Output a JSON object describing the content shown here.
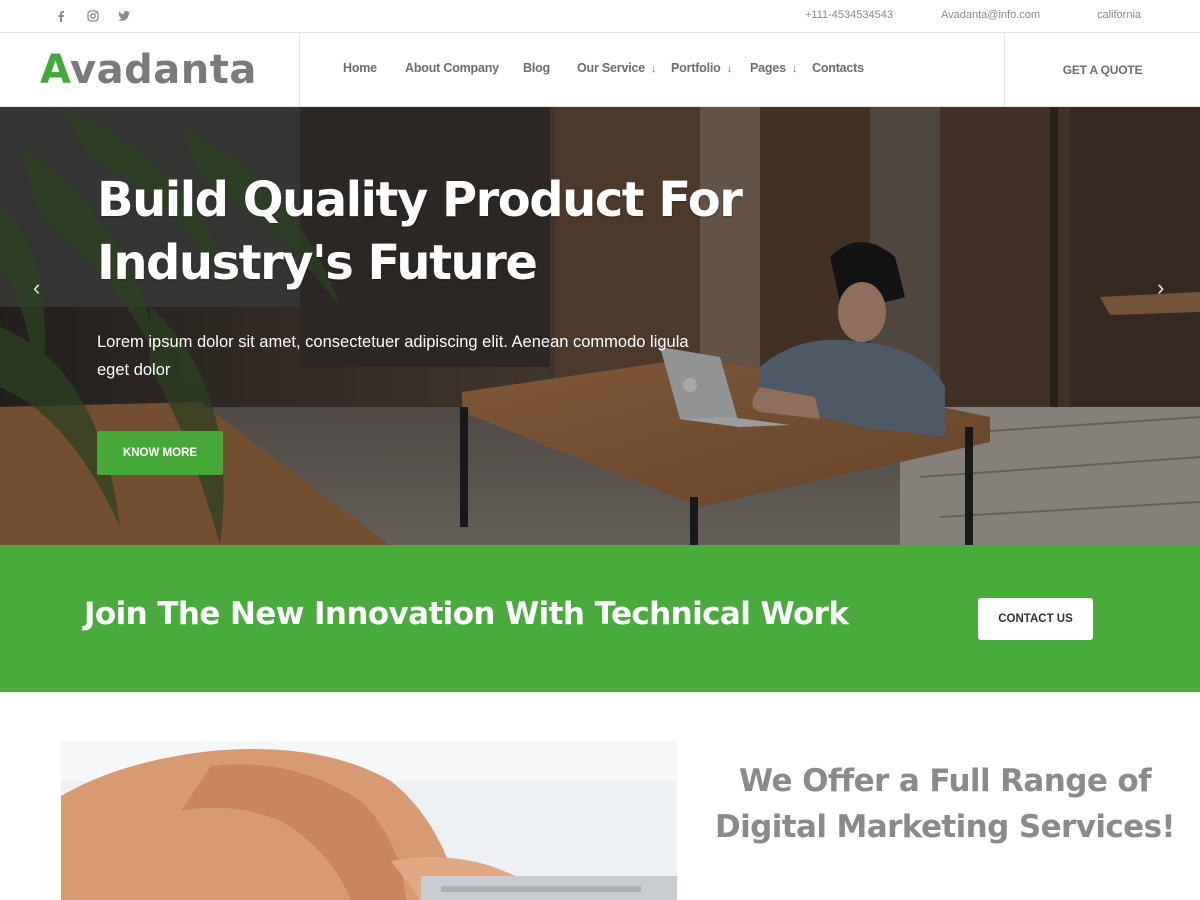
{
  "topbar": {
    "social": [
      {
        "icon": "facebook-icon",
        "glyph": "f"
      },
      {
        "icon": "instagram-icon",
        "glyph": ""
      },
      {
        "icon": "twitter-icon",
        "glyph": ""
      }
    ],
    "phone": "+111-4534534543",
    "email": "Avadanta@info.com",
    "location": "california"
  },
  "header": {
    "logo_accent": "A",
    "logo_rest": "vadanta",
    "nav": [
      {
        "label": "Home",
        "dropdown": false
      },
      {
        "label": "About Company",
        "dropdown": false
      },
      {
        "label": "Blog",
        "dropdown": false
      },
      {
        "label": "Our Service",
        "dropdown": true
      },
      {
        "label": "Portfolio",
        "dropdown": true
      },
      {
        "label": "Pages",
        "dropdown": true
      },
      {
        "label": "Contacts",
        "dropdown": false
      }
    ],
    "dropdown_glyph": "↓",
    "quote_label": "GET A QUOTE"
  },
  "hero": {
    "title": "Build Quality Product For Industry's Future",
    "text": "Lorem ipsum dolor sit amet, consectetuer adipiscing elit. Aenean commodo ligula eget dolor",
    "button": "KNOW MORE",
    "prev_glyph": "‹",
    "next_glyph": "›"
  },
  "banner": {
    "text": "Join The New Innovation With Technical Work",
    "button": "CONTACT US"
  },
  "services": {
    "title": "We Offer a Full Range of Digital Marketing Services!"
  },
  "colors": {
    "accent": "#47a83a",
    "banner": "#48ab3b",
    "text_gray": "#8a8a8a"
  }
}
